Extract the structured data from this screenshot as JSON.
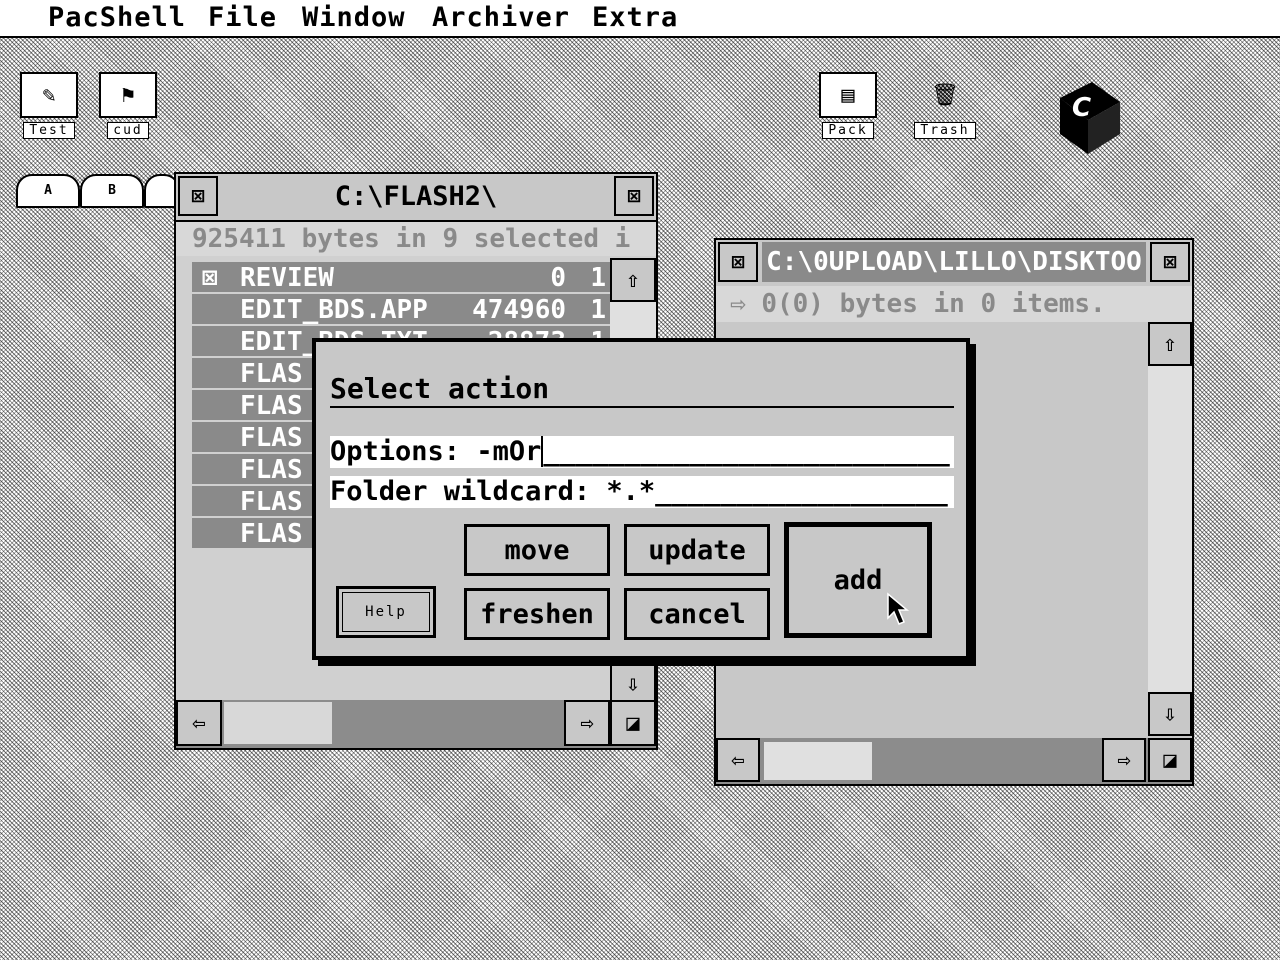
{
  "menubar": [
    "PacShell",
    "File",
    "Window",
    "Archiver",
    "Extra"
  ],
  "desktop_icons": {
    "test": {
      "label": "Test",
      "glyph": "✎"
    },
    "cud": {
      "label": "cud",
      "glyph": "⚑"
    },
    "pack": {
      "label": "Pack",
      "glyph": "▤"
    },
    "trash": {
      "label": "Trash",
      "glyph": "🗑"
    },
    "logo": {
      "glyph": "C"
    }
  },
  "drives": [
    "A",
    "B"
  ],
  "window1": {
    "title": "C:\\FLASH2\\",
    "info": "925411 bytes in 9 selected i",
    "files": [
      {
        "marker": "⊠",
        "name": "REVIEW",
        "size": "0",
        "extra": "1"
      },
      {
        "marker": "",
        "name": "EDIT_BDS.APP",
        "size": "474960",
        "extra": "1"
      },
      {
        "marker": "",
        "name": "EDIT_BDS.TXT",
        "size": "28873",
        "extra": "1"
      },
      {
        "marker": "",
        "name": "FLAS",
        "size": "",
        "extra": ""
      },
      {
        "marker": "",
        "name": "FLAS",
        "size": "",
        "extra": ""
      },
      {
        "marker": "",
        "name": "FLAS",
        "size": "",
        "extra": ""
      },
      {
        "marker": "",
        "name": "FLAS",
        "size": "",
        "extra": ""
      },
      {
        "marker": "",
        "name": "FLAS",
        "size": "",
        "extra": ""
      },
      {
        "marker": "",
        "name": "FLAS",
        "size": "",
        "extra": ""
      }
    ]
  },
  "window2": {
    "title": "C:\\0UPLOAD\\LILLO\\DISKTOO",
    "info": "0(0) bytes in 0 items."
  },
  "dialog": {
    "title": "Select action",
    "options_label": "Options: ",
    "options_value": "-mOr",
    "options_fill": "_________________________",
    "wildcard_label": "Folder wildcard: ",
    "wildcard_value": "*.*",
    "wildcard_fill": "__________________",
    "buttons": {
      "move": "move",
      "update": "update",
      "add": "add",
      "freshen": "freshen",
      "cancel": "cancel",
      "help": "Help"
    }
  },
  "icons": {
    "close": "⊠",
    "full": "⊠",
    "up": "⇧",
    "down": "⇩",
    "left": "⇦",
    "right": "⇨",
    "size": "◪"
  }
}
